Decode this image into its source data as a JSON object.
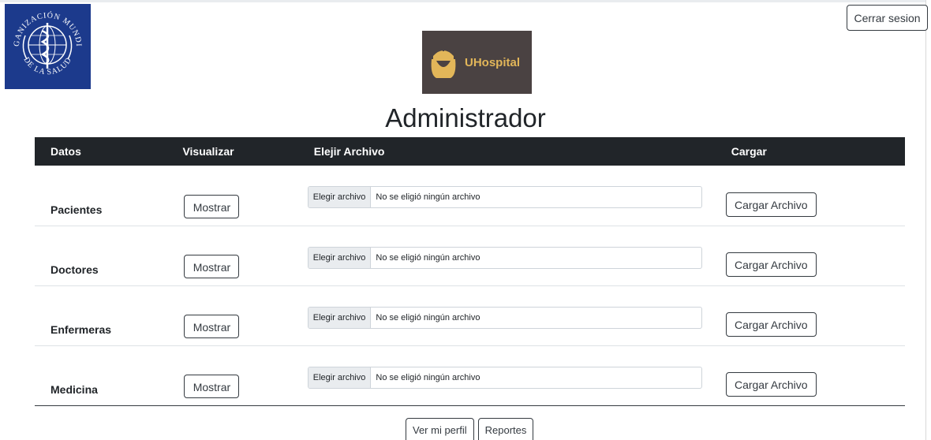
{
  "header": {
    "logout_label": "Cerrar sesion",
    "brand_name": "UHospital",
    "oms_logo_text": "ORGANIZACIÓN MUNDIAL DE LA SALUD"
  },
  "page_title": "Administrador",
  "table": {
    "headers": [
      "Datos",
      "Visualizar",
      "Elejir Archivo",
      "Cargar"
    ],
    "rows": [
      {
        "label": "Pacientes",
        "show_label": "Mostrar",
        "file_button": "Elegir archivo",
        "file_status": "No se eligió ningún archivo",
        "load_label": "Cargar Archivo"
      },
      {
        "label": "Doctores",
        "show_label": "Mostrar",
        "file_button": "Elegir archivo",
        "file_status": "No se eligió ningún archivo",
        "load_label": "Cargar Archivo"
      },
      {
        "label": "Enfermeras",
        "show_label": "Mostrar",
        "file_button": "Elegir archivo",
        "file_status": "No se eligió ningún archivo",
        "load_label": "Cargar Archivo"
      },
      {
        "label": "Medicina",
        "show_label": "Mostrar",
        "file_button": "Elegir archivo",
        "file_status": "No se eligió ningún archivo",
        "load_label": "Cargar Archivo"
      }
    ]
  },
  "footer": {
    "profile_label": "Ver mi perfil",
    "reports_label": "Reportes"
  },
  "colors": {
    "table_header_bg": "#212529",
    "oms_blue": "#1c3a8c",
    "brand_gold": "#e2b659",
    "brand_bg": "#4a4242"
  }
}
